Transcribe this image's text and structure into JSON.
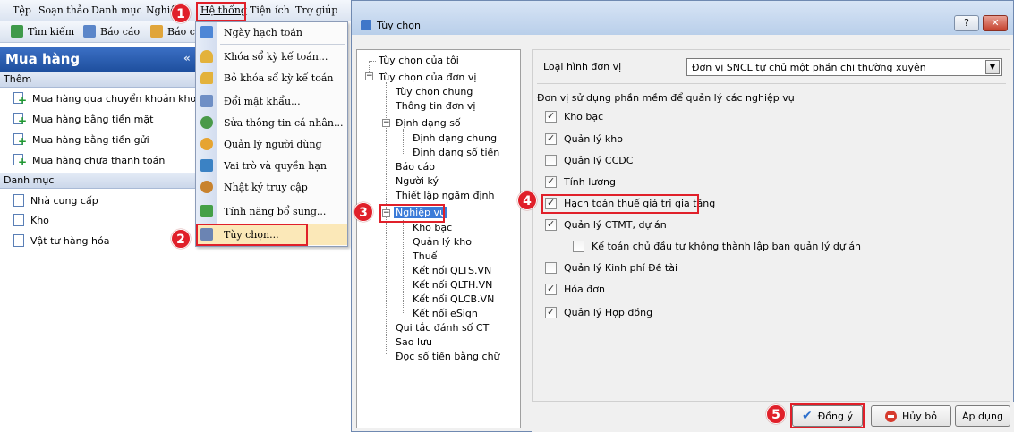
{
  "menubar": {
    "items": [
      "Tệp",
      "Soạn thảo",
      "Danh mục",
      "Nghiệ",
      "Hệ thống",
      "Tiện ích",
      "Trợ giúp"
    ]
  },
  "toolbar": {
    "search_label": "Tìm kiếm",
    "report_label": "Báo cáo",
    "report2_label": "Báo c"
  },
  "left_panel": {
    "title": "Mua hàng",
    "collapse_glyph": "«",
    "section_add": "Thêm",
    "add_items": [
      "Mua hàng qua chuyển khoản kho...",
      "Mua hàng bằng tiền mặt",
      "Mua hàng bằng tiền gửi",
      "Mua hàng chưa thanh toán"
    ],
    "section_catalog": "Danh mục",
    "catalog_items": [
      "Nhà cung cấp",
      "Kho",
      "Vật tư hàng hóa"
    ]
  },
  "system_menu": {
    "items": [
      {
        "label": "Ngày hạch toán",
        "icon": "calendar-icon",
        "color": "#4d86d6"
      },
      {
        "label": "Khóa sổ kỳ kế toán...",
        "icon": "lock-icon",
        "color": "#e3b23c"
      },
      {
        "label": "Bỏ khóa sổ kỳ kế toán",
        "icon": "unlock-icon",
        "color": "#e3b23c"
      },
      {
        "label": "Đổi mật khẩu...",
        "icon": "key-icon",
        "color": "#6f8fc5"
      },
      {
        "label": "Sửa thông tin cá nhân...",
        "icon": "user-edit-icon",
        "color": "#4a9a4a"
      },
      {
        "label": "Quản lý người dùng",
        "icon": "users-icon",
        "color": "#e6a431"
      },
      {
        "label": "Vai trò và quyền hạn",
        "icon": "role-icon",
        "color": "#3b82c4"
      },
      {
        "label": "Nhật ký truy cập",
        "icon": "footprints-icon",
        "color": "#c8832f"
      },
      {
        "label": "Tính năng bổ sung...",
        "icon": "puzzle-icon",
        "color": "#44a047"
      },
      {
        "label": "Tùy chọn...",
        "icon": "tools-icon",
        "color": "#6b84b3"
      }
    ]
  },
  "dialog": {
    "title": "Tùy chọn",
    "help_glyph": "?",
    "close_glyph": "✕",
    "tree": [
      "Tùy chọn của tôi",
      "Tùy chọn của đơn vị",
      "Tùy chọn chung",
      "Thông tin đơn vị",
      "Định dạng số",
      "Định dạng chung",
      "Định dạng số tiền",
      "Báo cáo",
      "Người ký",
      "Thiết lập ngầm định",
      "Nghiệp vụ",
      "Kho bạc",
      "Quản lý kho",
      "Thuế",
      "Kết nối QLTS.VN",
      "Kết nối QLTH.VN",
      "Kết nối QLCB.VN",
      "Kết nối eSign",
      "Qui tắc đánh số CT",
      "Sao lưu",
      "Đọc số tiền bằng chữ"
    ],
    "unit_type_label": "Loại hình đơn vị",
    "unit_type_value": "Đơn vị SNCL tự chủ một phần chi thường xuyên",
    "usage_label": "Đơn vị sử dụng phần mềm để quản lý các nghiệp vụ",
    "options": [
      {
        "label": "Kho bạc",
        "checked": true
      },
      {
        "label": "Quản lý kho",
        "checked": true
      },
      {
        "label": "Quản lý CCDC",
        "checked": false
      },
      {
        "label": "Tính lương",
        "checked": true
      },
      {
        "label": "Hạch toán thuế giá trị gia tăng",
        "checked": true
      },
      {
        "label": "Quản lý CTMT, dự án",
        "checked": true
      },
      {
        "label": "Kế toán chủ đầu tư không thành lập ban quản lý dự án",
        "checked": false
      },
      {
        "label": "Quản lý Kinh phí Đề tài",
        "checked": false
      },
      {
        "label": "Hóa đơn",
        "checked": true
      },
      {
        "label": "Quản lý Hợp đồng",
        "checked": true
      }
    ],
    "ok_label": "Đồng ý",
    "cancel_label": "Hủy bỏ",
    "apply_label": "Áp dụng"
  },
  "callouts": [
    "1",
    "2",
    "3",
    "4",
    "5"
  ],
  "colors": {
    "accent_red": "#e0202a",
    "panel_blue": "#1e4f9e"
  }
}
